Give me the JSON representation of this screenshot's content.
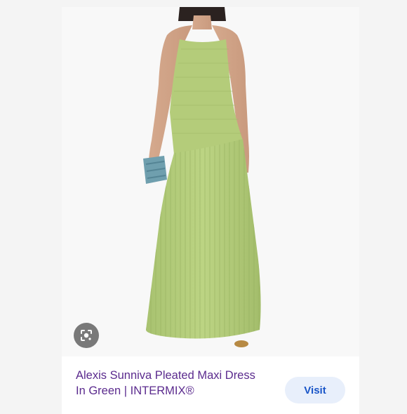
{
  "result": {
    "title": "Alexis Sunniva Pleated Maxi Dress In Green | INTERMIX®",
    "visit_label": "Visit",
    "image_alt_icon": "google-lens-icon"
  },
  "colors": {
    "dress": "#b7cf7d",
    "title_text": "#5b2b8e",
    "visit_text": "#1a56c8",
    "visit_bg": "#e8effb",
    "clutch": "#6f9fae"
  }
}
